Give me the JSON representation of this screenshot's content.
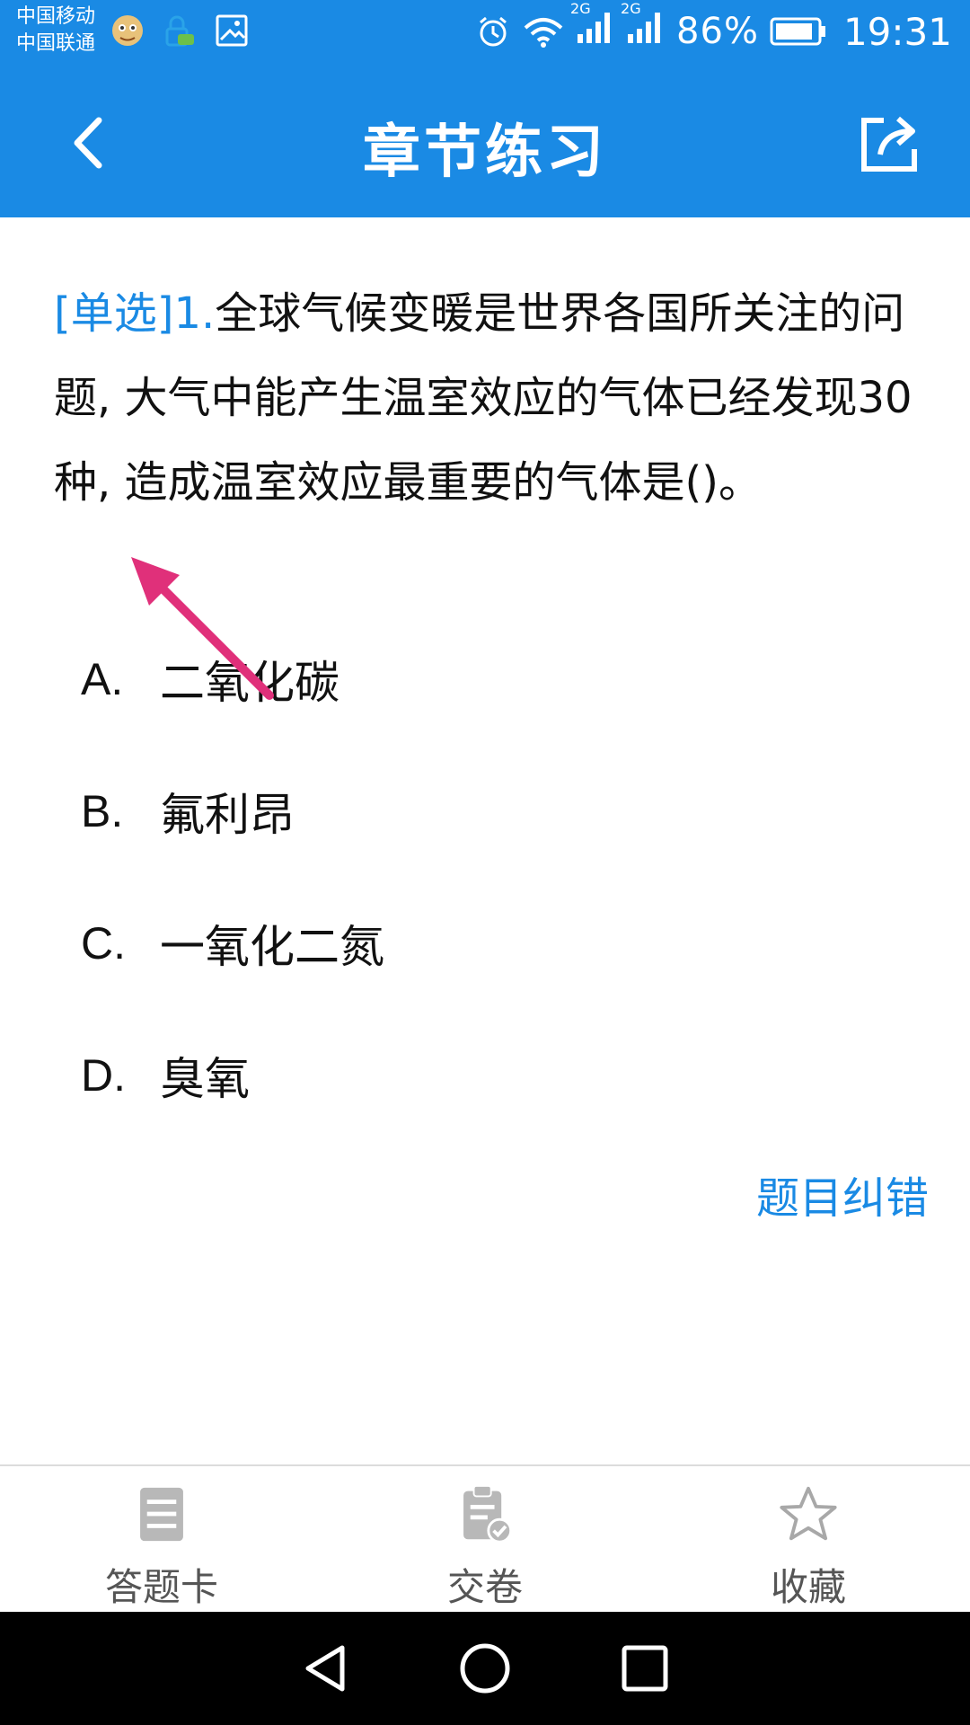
{
  "status_bar": {
    "carrier_1": "中国移动",
    "carrier_2": "中国联通",
    "signal_1": "2G",
    "signal_2": "2G",
    "battery": "86%",
    "time": "19:31"
  },
  "header": {
    "title": "章节练习",
    "back_icon": "back-arrow-icon",
    "share_icon": "share-icon"
  },
  "question": {
    "tag": "[单选]",
    "number": "1.",
    "text": "全球气候变暖是世界各国所关注的问题, 大气中能产生温室效应的气体已经发现30种, 造成温室效应最重要的气体是()。"
  },
  "options": [
    {
      "letter": "A.",
      "text": "二氧化碳"
    },
    {
      "letter": "B.",
      "text": "氟利昂"
    },
    {
      "letter": "C.",
      "text": "一氧化二氮"
    },
    {
      "letter": "D.",
      "text": "臭氧"
    }
  ],
  "correct_link": "题目纠错",
  "bottom_tabs": [
    {
      "label": "答题卡",
      "icon": "answer-card-icon"
    },
    {
      "label": "交卷",
      "icon": "submit-paper-icon"
    },
    {
      "label": "收藏",
      "icon": "star-icon"
    }
  ],
  "colors": {
    "primary": "#1a8ae4",
    "annotation_arrow": "#e0307a"
  }
}
